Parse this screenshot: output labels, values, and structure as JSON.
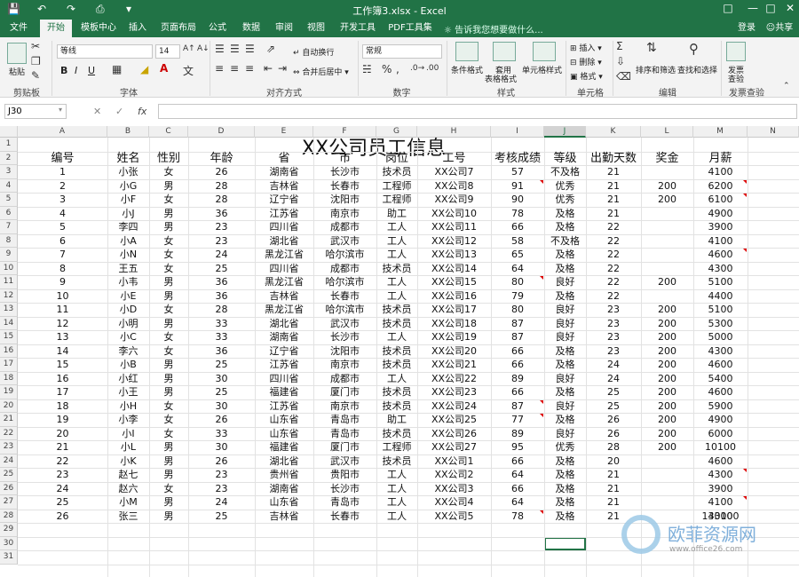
{
  "title_bar": {
    "title": "工作簿3.xlsx - Excel"
  },
  "menu": {
    "tabs": [
      "文件",
      "开始",
      "模板中心",
      "插入",
      "页面布局",
      "公式",
      "数据",
      "审阅",
      "视图",
      "开发工具",
      "PDF工具集"
    ],
    "active_index": 1,
    "tell_me": "告诉我您想要做什么...",
    "login": "登录",
    "share": "共享"
  },
  "ribbon": {
    "groups": [
      "剪贴板",
      "字体",
      "对齐方式",
      "数字",
      "样式",
      "单元格",
      "编辑",
      "发票查验"
    ],
    "paste": "粘贴",
    "font_name": "等线",
    "font_size": "14",
    "bold": "B",
    "italic": "I",
    "underline": "U",
    "wrap_text": "自动换行",
    "merge_center": "合并后居中",
    "number_format": "常规",
    "conditional_format": "条件格式",
    "table_format_1": "套用",
    "table_format_2": "表格格式",
    "cell_styles": "单元格样式",
    "insert": "插入",
    "delete": "删除",
    "format": "格式",
    "sort_filter": "排序和筛选",
    "find_select": "查找和选择",
    "invoice_1": "发票",
    "invoice_2": "查验"
  },
  "formula_bar": {
    "name_box": "J30",
    "fx": "fx"
  },
  "columns": [
    "A",
    "B",
    "C",
    "D",
    "E",
    "F",
    "G",
    "H",
    "I",
    "J",
    "K",
    "L",
    "M",
    "N"
  ],
  "selected_column": "J",
  "sheet": {
    "title": "XX公司员工信息",
    "headers": [
      "编号",
      "姓名",
      "性别",
      "年龄",
      "省",
      "市",
      "岗位",
      "工号",
      "考核成绩",
      "等级",
      "出勤天数",
      "奖金",
      "月薪"
    ],
    "rows": [
      [
        "1",
        "小张",
        "女",
        "26",
        "湖南省",
        "长沙市",
        "技术员",
        "XX公司7",
        "57",
        "不及格",
        "21",
        "",
        "4100"
      ],
      [
        "2",
        "小G",
        "男",
        "28",
        "吉林省",
        "长春市",
        "工程师",
        "XX公司8",
        "91",
        "优秀",
        "21",
        "200",
        "6200"
      ],
      [
        "3",
        "小F",
        "女",
        "28",
        "辽宁省",
        "沈阳市",
        "工程师",
        "XX公司9",
        "90",
        "优秀",
        "21",
        "200",
        "6100"
      ],
      [
        "4",
        "小J",
        "男",
        "36",
        "江苏省",
        "南京市",
        "助工",
        "XX公司10",
        "78",
        "及格",
        "21",
        "",
        "4900"
      ],
      [
        "5",
        "李四",
        "男",
        "23",
        "四川省",
        "成都市",
        "工人",
        "XX公司11",
        "66",
        "及格",
        "22",
        "",
        "3900"
      ],
      [
        "6",
        "小A",
        "女",
        "23",
        "湖北省",
        "武汉市",
        "工人",
        "XX公司12",
        "58",
        "不及格",
        "22",
        "",
        "4100"
      ],
      [
        "7",
        "小N",
        "女",
        "24",
        "黑龙江省",
        "哈尔滨市",
        "工人",
        "XX公司13",
        "65",
        "及格",
        "22",
        "",
        "4600"
      ],
      [
        "8",
        "王五",
        "女",
        "25",
        "四川省",
        "成都市",
        "技术员",
        "XX公司14",
        "64",
        "及格",
        "22",
        "",
        "4300"
      ],
      [
        "9",
        "小韦",
        "男",
        "36",
        "黑龙江省",
        "哈尔滨市",
        "工人",
        "XX公司15",
        "80",
        "良好",
        "22",
        "200",
        "5100"
      ],
      [
        "10",
        "小E",
        "男",
        "36",
        "吉林省",
        "长春市",
        "工人",
        "XX公司16",
        "79",
        "及格",
        "22",
        "",
        "4400"
      ],
      [
        "11",
        "小D",
        "女",
        "28",
        "黑龙江省",
        "哈尔滨市",
        "技术员",
        "XX公司17",
        "80",
        "良好",
        "23",
        "200",
        "5100"
      ],
      [
        "12",
        "小明",
        "男",
        "33",
        "湖北省",
        "武汉市",
        "技术员",
        "XX公司18",
        "87",
        "良好",
        "23",
        "200",
        "5300"
      ],
      [
        "13",
        "小C",
        "女",
        "33",
        "湖南省",
        "长沙市",
        "工人",
        "XX公司19",
        "87",
        "良好",
        "23",
        "200",
        "5000"
      ],
      [
        "14",
        "李六",
        "女",
        "36",
        "辽宁省",
        "沈阳市",
        "技术员",
        "XX公司20",
        "66",
        "及格",
        "23",
        "200",
        "4300"
      ],
      [
        "15",
        "小B",
        "男",
        "25",
        "江苏省",
        "南京市",
        "技术员",
        "XX公司21",
        "66",
        "及格",
        "24",
        "200",
        "4600"
      ],
      [
        "16",
        "小红",
        "男",
        "30",
        "四川省",
        "成都市",
        "工人",
        "XX公司22",
        "89",
        "良好",
        "24",
        "200",
        "5400"
      ],
      [
        "17",
        "小王",
        "男",
        "25",
        "福建省",
        "厦门市",
        "技术员",
        "XX公司23",
        "66",
        "及格",
        "25",
        "200",
        "4600"
      ],
      [
        "18",
        "小H",
        "女",
        "30",
        "江苏省",
        "南京市",
        "技术员",
        "XX公司24",
        "87",
        "良好",
        "25",
        "200",
        "5900"
      ],
      [
        "19",
        "小李",
        "女",
        "26",
        "山东省",
        "青岛市",
        "助工",
        "XX公司25",
        "77",
        "及格",
        "26",
        "200",
        "4900"
      ],
      [
        "20",
        "小I",
        "女",
        "33",
        "山东省",
        "青岛市",
        "技术员",
        "XX公司26",
        "89",
        "良好",
        "26",
        "200",
        "6000"
      ],
      [
        "21",
        "小L",
        "男",
        "30",
        "福建省",
        "厦门市",
        "工程师",
        "XX公司27",
        "95",
        "优秀",
        "28",
        "200",
        "10100"
      ],
      [
        "22",
        "小K",
        "男",
        "26",
        "湖北省",
        "武汉市",
        "技术员",
        "XX公司1",
        "66",
        "及格",
        "20",
        "",
        "4600"
      ],
      [
        "23",
        "赵七",
        "男",
        "23",
        "贵州省",
        "贵阳市",
        "工人",
        "XX公司2",
        "64",
        "及格",
        "21",
        "",
        "4300"
      ],
      [
        "24",
        "赵六",
        "女",
        "23",
        "湖南省",
        "长沙市",
        "工人",
        "XX公司3",
        "66",
        "及格",
        "21",
        "",
        "3900"
      ],
      [
        "25",
        "小M",
        "男",
        "24",
        "山东省",
        "青岛市",
        "工人",
        "XX公司4",
        "64",
        "及格",
        "21",
        "",
        "4100"
      ],
      [
        "26",
        "张三",
        "男",
        "25",
        "吉林省",
        "长春市",
        "工人",
        "XX公司5",
        "78",
        "及格",
        "21",
        "",
        "4300"
      ]
    ],
    "total": "130100"
  },
  "watermark": {
    "cn": "欧菲资源网",
    "en": "www.office26.com"
  },
  "colors": {
    "accent": "#217346",
    "comment_marker": "#dd0000"
  }
}
